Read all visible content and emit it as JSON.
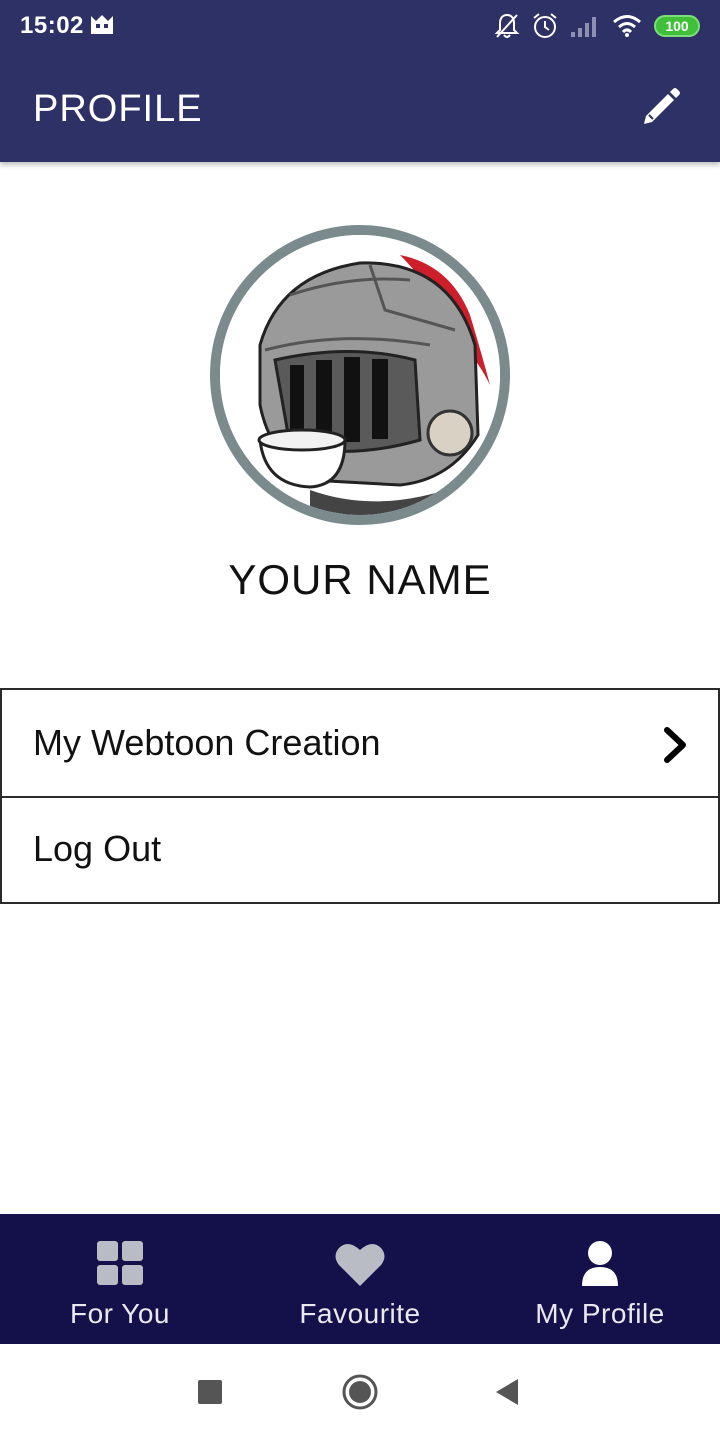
{
  "status_bar": {
    "time": "15:02",
    "battery": "100",
    "icons": [
      "notifications-off-icon",
      "alarm-icon",
      "signal-icon",
      "wifi-icon",
      "battery-icon"
    ],
    "left_icon": "app-notification-icon"
  },
  "app_bar": {
    "title": "PROFILE",
    "edit_icon": "pencil-icon"
  },
  "profile": {
    "avatar_icon": "knight-helmet-avatar",
    "name": "YOUR NAME"
  },
  "menu": {
    "items": [
      {
        "label": "My Webtoon Creation",
        "icon": "chevron-right-icon"
      },
      {
        "label": "Log Out"
      }
    ]
  },
  "bottom_nav": {
    "items": [
      {
        "label": "For You",
        "icon": "grid-icon"
      },
      {
        "label": "Favourite",
        "icon": "heart-icon"
      },
      {
        "label": "My Profile",
        "icon": "user-icon"
      }
    ],
    "active": "My Profile"
  },
  "colors": {
    "primary": "#2e3166",
    "bottom_nav": "#13104a",
    "avatar_ring": "#7b8a8d",
    "nav_icon_inactive": "#b9bcc4"
  }
}
